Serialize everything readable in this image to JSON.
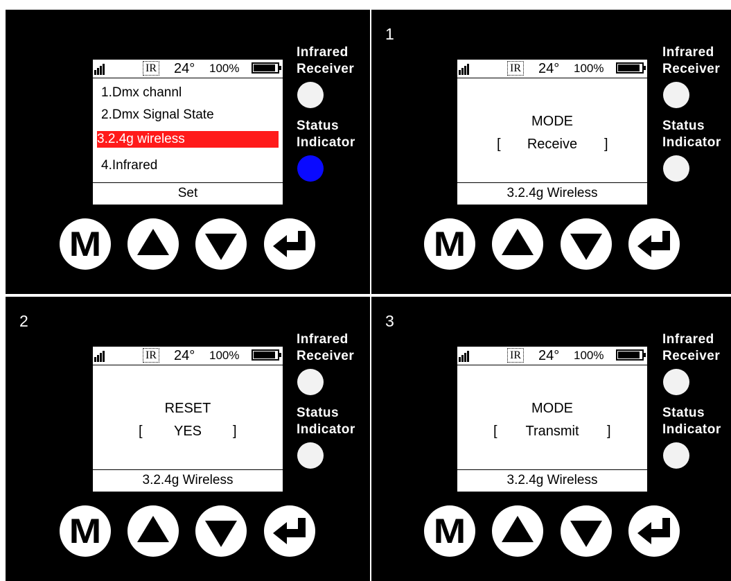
{
  "labels": {
    "infrared": "Infrared Receiver",
    "infrared_line1": "Infrared",
    "infrared_line2": "Receiver",
    "status_line1": "Status",
    "status_line2": "Indicator"
  },
  "status_bar": {
    "ir": "IR",
    "temperature": "24°",
    "battery_percent": "100%",
    "battery_level": 0.93
  },
  "buttons": {
    "menu": "M",
    "up_icon": "up-triangle-icon",
    "down_icon": "down-triangle-icon",
    "enter_icon": "enter-return-icon"
  },
  "panels": [
    {
      "number": "",
      "status_light_color": "#0a0aff",
      "menu": [
        "1.Dmx channl",
        "2.Dmx Signal State",
        "3.2.4g wireless",
        "4.Infrared"
      ],
      "selected_index": 2,
      "footer": "Set"
    },
    {
      "number": "1",
      "status_light_color": "#f2f2f2",
      "title": "MODE",
      "value": "Receive",
      "footer": "3.2.4g Wireless"
    },
    {
      "number": "2",
      "status_light_color": "#f2f2f2",
      "title": "RESET",
      "value": "YES",
      "footer": "3.2.4g Wireless"
    },
    {
      "number": "3",
      "status_light_color": "#f2f2f2",
      "title": "MODE",
      "value": "Transmit",
      "footer": "3.2.4g Wireless"
    }
  ]
}
